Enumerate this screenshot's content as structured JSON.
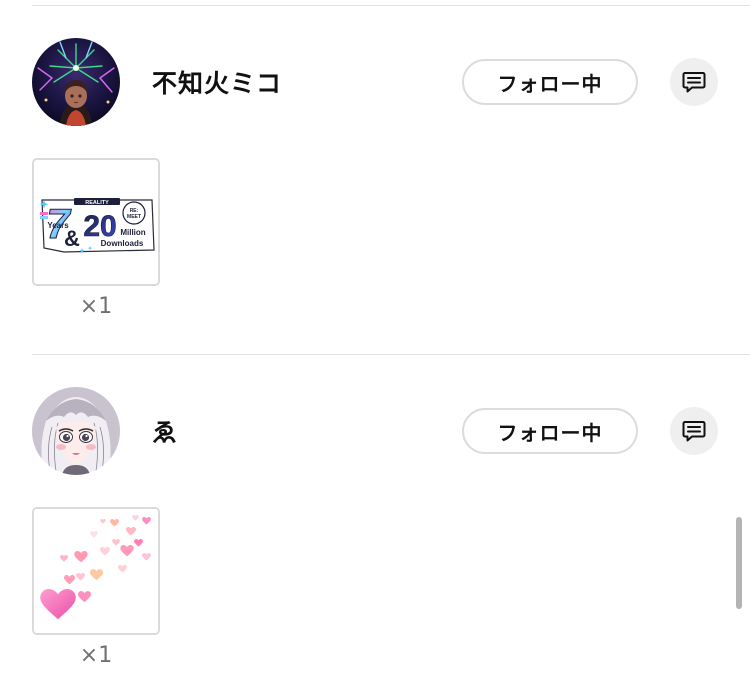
{
  "follow_list": [
    {
      "username": "不知火ミコ",
      "follow_label": "フォロー中",
      "message_icon": "message-icon",
      "gift": {
        "image": "reality-7-years-20-million-downloads-badge",
        "badge_text": {
          "brand": "REALITY",
          "re": "RE:",
          "meet": "MEET",
          "big_number": "7",
          "years": "Years",
          "ampersand": "&",
          "twenty": "20",
          "million": "Million",
          "downloads": "Downloads"
        },
        "count": "×1"
      }
    },
    {
      "username": "ゑ",
      "follow_label": "フォロー中",
      "message_icon": "message-icon",
      "gift": {
        "image": "floating-pink-hearts",
        "count": "×1"
      }
    }
  ],
  "colors": {
    "text": "#111111",
    "muted": "#707070",
    "border": "#dcdcdc",
    "icon_bg": "#efefef",
    "divider": "#e3e3e3"
  }
}
